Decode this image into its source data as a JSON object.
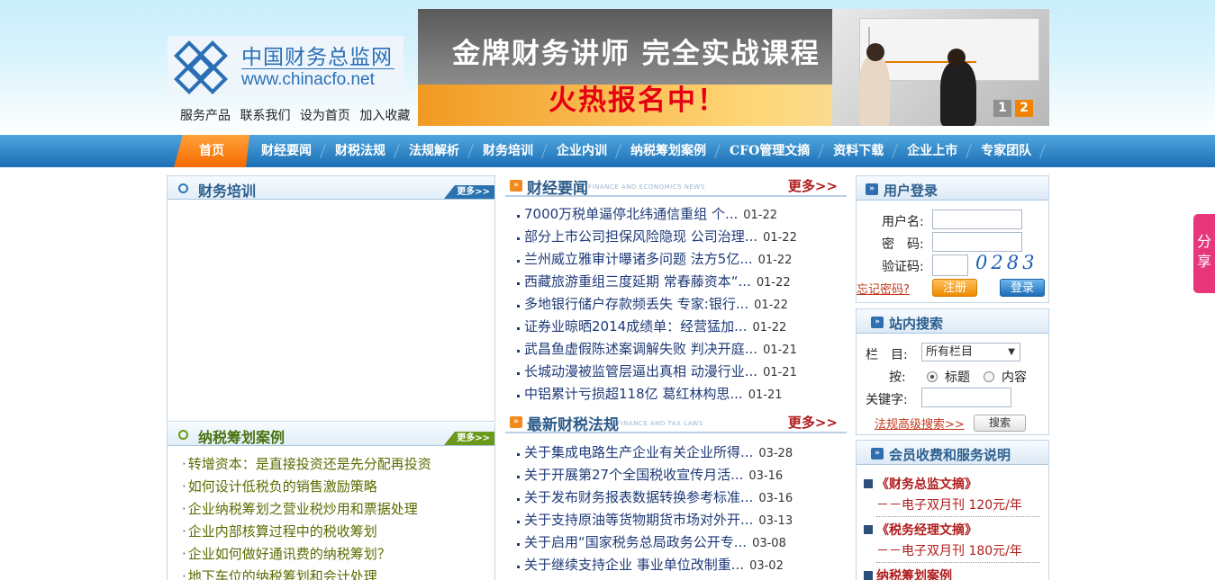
{
  "site": {
    "name_cn": "中国财务总监网",
    "name_en": "www.chinacfo.net",
    "top_links": [
      "服务产品",
      "联系我们",
      "设为首页",
      "加入收藏"
    ]
  },
  "banner": {
    "line1": "金牌财务讲师  完全实战课程",
    "line2": "火热报名中！",
    "pages": [
      "1",
      "2"
    ]
  },
  "nav": {
    "items": [
      "首页",
      "财经要闻",
      "财税法规",
      "法规解析",
      "财务培训",
      "企业内训",
      "纳税筹划案例",
      "CFO管理文摘",
      "资料下载",
      "企业上市",
      "专家团队"
    ],
    "active": "首页"
  },
  "left": {
    "training": {
      "title": "财务培训",
      "more": "更多>>"
    },
    "cases": {
      "title": "纳税筹划案例",
      "more": "更多>>",
      "items": [
        "转增资本：是直接投资还是先分配再投资",
        "如何设计低税负的销售激励策略",
        "企业纳税筹划之营业税炒用和票据处理",
        "企业内部核算过程中的税收筹划",
        "企业如何做好通讯费的纳税筹划？",
        "地下车位的纳税筹划和会计处理"
      ]
    }
  },
  "middle": {
    "news": {
      "title": "财经要闻",
      "subtitle": "FINANCE AND ECONOMICS NEWS",
      "more": "更多>>",
      "items": [
        {
          "title": "7000万税单逼停北纬通信重组 个...",
          "date": "01-22"
        },
        {
          "title": "部分上市公司担保风险隐现 公司治理...",
          "date": "01-22"
        },
        {
          "title": "兰州威立雅审计曝诸多问题 法方5亿...",
          "date": "01-22"
        },
        {
          "title": "西藏旅游重组三度延期 常春藤资本“...",
          "date": "01-22"
        },
        {
          "title": "多地银行储户存款频丢失 专家:银行...",
          "date": "01-22"
        },
        {
          "title": "证券业晾晒2014成绩单：经营猛加...",
          "date": "01-22"
        },
        {
          "title": "武昌鱼虚假陈述案调解失败 判决开庭...",
          "date": "01-21"
        },
        {
          "title": "长城动漫被监管层逼出真相 动漫行业...",
          "date": "01-21"
        },
        {
          "title": "中铝累计亏损超118亿 葛红林构思...",
          "date": "01-21"
        }
      ]
    },
    "laws": {
      "title": "最新财税法规",
      "subtitle": "FINANCE AND TAX LAWS",
      "more": "更多>>",
      "items": [
        {
          "title": "关于集成电路生产企业有关企业所得...",
          "date": "03-28"
        },
        {
          "title": "关于开展第27个全国税收宣传月活...",
          "date": "03-16"
        },
        {
          "title": "关于发布财务报表数据转换参考标准...",
          "date": "03-16"
        },
        {
          "title": "关于支持原油等货物期货市场对外开...",
          "date": "03-13"
        },
        {
          "title": "关于启用“国家税务总局政务公开专...",
          "date": "03-08"
        },
        {
          "title": "关于继续支持企业 事业单位改制重...",
          "date": "03-02"
        }
      ]
    }
  },
  "right": {
    "login": {
      "title": "用户登录",
      "username_label": "用户名:",
      "password_label": "密　码:",
      "captcha_label": "验证码:",
      "captcha_text": "0283",
      "forgot": "忘记密码?",
      "register": "注册",
      "login": "登录"
    },
    "search": {
      "title": "站内搜索",
      "column_label": "栏　目:",
      "column_value": "所有栏目",
      "by_label": "按:",
      "option_title": "标题",
      "option_content": "内容",
      "keyword_label": "关键字:",
      "advanced": "法规高级搜索>>",
      "button": "搜索"
    },
    "membership": {
      "title": "会员收费和服务说明",
      "items": [
        {
          "name": "《财务总监文摘》",
          "desc": "－－电子双月刊 120元/年"
        },
        {
          "name": "《税务经理文摘》",
          "desc": "－－电子双月刊 180元/年"
        },
        {
          "name": "纳税筹划案例",
          "desc": ""
        }
      ]
    }
  },
  "share": {
    "label": "分享"
  },
  "colors": {
    "nav_blue": "#1b6eb4",
    "nav_active": "#f56a00",
    "accent_red": "#b01c1c",
    "share_pink": "#e8367b"
  }
}
